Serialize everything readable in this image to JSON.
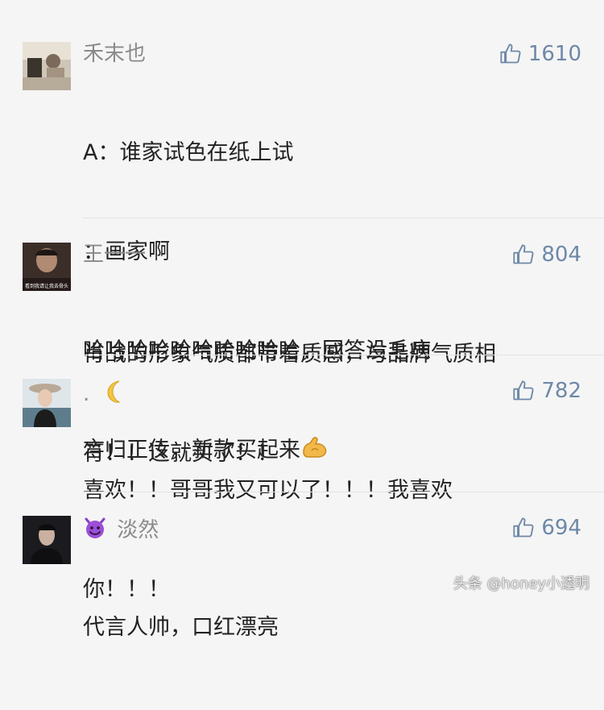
{
  "comments": [
    {
      "username": "禾末也",
      "likes": "1610",
      "lines": [
        "A：谁家试色在纸上试",
        "：画家啊",
        "哈哈哈哈哈哈哈哈哈哈，回答没毛病",
        "言归正传，新款买起来"
      ]
    },
    {
      "username": "王一一",
      "likes": "804",
      "avatar_caption": "看到我请让我去骨头",
      "lines": [
        "肖战的形象气质都带着质感，与品牌气质相",
        "符！！这就买了！！"
      ]
    },
    {
      "username": ".",
      "likes": "782",
      "lines": [
        "喜欢！！哥哥我又可以了！！！我喜欢",
        "你！！！"
      ]
    },
    {
      "username": "淡然",
      "likes": "694",
      "lines": [
        "代言人帅，口红漂亮"
      ]
    }
  ],
  "watermark": "头条 @honey小透明",
  "colors": {
    "like": "#6e88a8",
    "name": "#8a8a8a",
    "text": "#222222",
    "background": "#f5f5f5"
  }
}
